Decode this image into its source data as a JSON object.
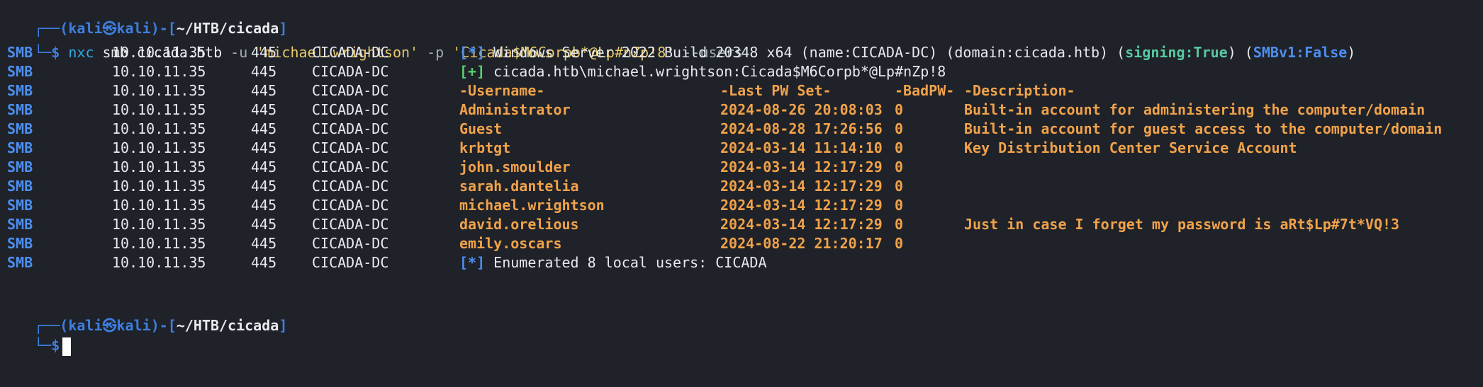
{
  "prompt1": {
    "corner": "┌──",
    "open": "(",
    "user": "kali",
    "at": "㉿",
    "host": "kali",
    "close": ")-[",
    "path": "~/HTB/cicada",
    "end": "]",
    "branch": "└─",
    "dollar": "$"
  },
  "command": {
    "bin": "nxc",
    "proto": "smb",
    "target": "cicada.htb",
    "flag_u": "-u",
    "user_value": "'michael.wrightson'",
    "flag_p": "-p",
    "pass_value": "'Cicada$M6Corpb*@Lp#nZp!8'",
    "flag_users": "--users"
  },
  "rows_common": {
    "proto": "SMB",
    "ip": "10.10.11.35",
    "port": "445",
    "host": "CICADA-DC"
  },
  "info_line": {
    "mark": "[*]",
    "text_a": " Windows Server 2022 Build 20348 x64 (name:CICADA-DC) (domain:cicada.htb) (",
    "signing": "signing:True",
    "text_b": ") (",
    "smbv1": "SMBv1:False",
    "text_c": ")"
  },
  "auth_line": {
    "mark": "[+]",
    "text": " cicada.htb\\michael.wrightson:Cicada$M6Corpb*@Lp#nZp!8"
  },
  "headers": {
    "username": "-Username-",
    "last_pw_set": "-Last PW Set-",
    "bad_pw": "-BadPW-",
    "description": "-Description-"
  },
  "users": [
    {
      "name": "Administrator",
      "pwset": "2024-08-26 20:08:03",
      "bad": "0",
      "desc": "Built-in account for administering the computer/domain"
    },
    {
      "name": "Guest",
      "pwset": "2024-08-28 17:26:56",
      "bad": "0",
      "desc": "Built-in account for guest access to the computer/domain"
    },
    {
      "name": "krbtgt",
      "pwset": "2024-03-14 11:14:10",
      "bad": "0",
      "desc": "Key Distribution Center Service Account"
    },
    {
      "name": "john.smoulder",
      "pwset": "2024-03-14 12:17:29",
      "bad": "0",
      "desc": ""
    },
    {
      "name": "sarah.dantelia",
      "pwset": "2024-03-14 12:17:29",
      "bad": "0",
      "desc": ""
    },
    {
      "name": "michael.wrightson",
      "pwset": "2024-03-14 12:17:29",
      "bad": "0",
      "desc": ""
    },
    {
      "name": "david.orelious",
      "pwset": "2024-03-14 12:17:29",
      "bad": "0",
      "desc": "Just in case I forget my password is aRt$Lp#7t*VQ!3"
    },
    {
      "name": "emily.oscars",
      "pwset": "2024-08-22 21:20:17",
      "bad": "0",
      "desc": ""
    }
  ],
  "summary_line": {
    "mark": "[*]",
    "text": " Enumerated 8 local users: CICADA"
  },
  "prompt2": {
    "corner": "┌──",
    "open": "(",
    "user": "kali",
    "at": "㉿",
    "host": "kali",
    "close": ")-[",
    "path": "~/HTB/cicada",
    "end": "]",
    "branch": "└─",
    "dollar": "$"
  },
  "colors": {
    "background": "#1f2229",
    "prompt": "#3d7fe0",
    "proto": "#4b8ff0",
    "highlight": "#f0a24a",
    "signing": "#58c8a0",
    "success": "#58d06a"
  }
}
